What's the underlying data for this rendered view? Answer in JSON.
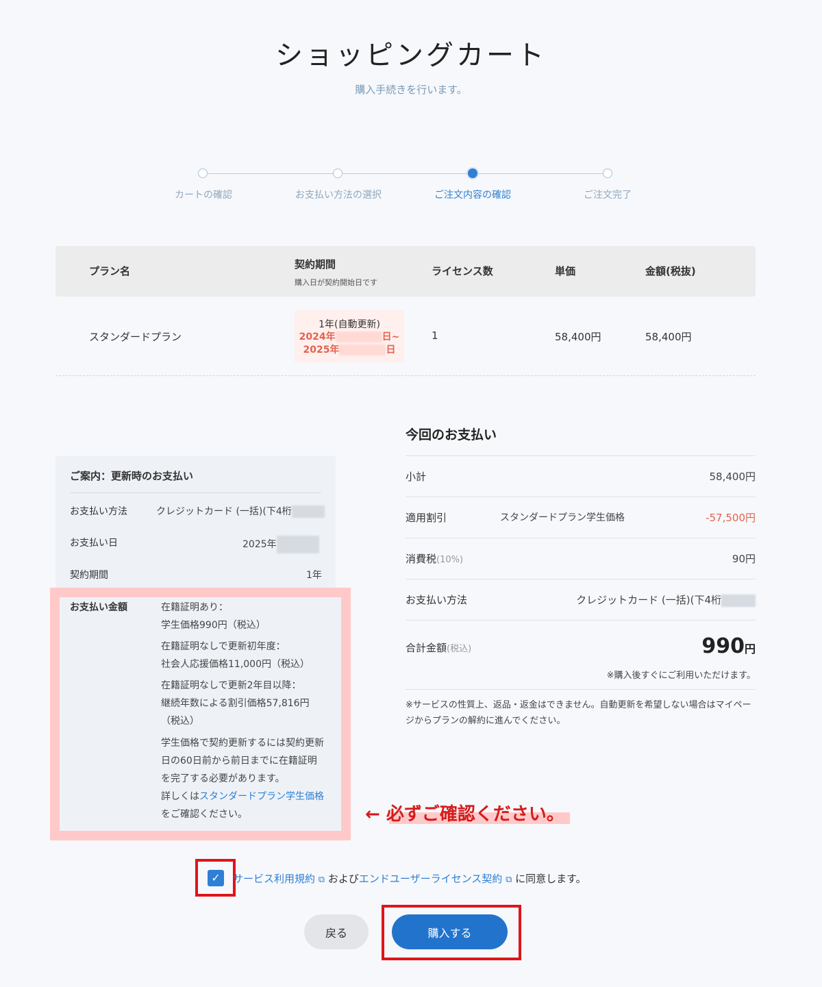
{
  "header": {
    "title": "ショッピングカート",
    "subtitle": "購入手続きを行います。"
  },
  "stepper": {
    "steps": [
      {
        "label": "カートの確認",
        "active": false
      },
      {
        "label": "お支払い方法の選択",
        "active": false
      },
      {
        "label": "ご注文内容の確認",
        "active": true
      },
      {
        "label": "ご注文完了",
        "active": false
      }
    ]
  },
  "table": {
    "headers": {
      "plan": "プラン名",
      "period": "契約期間",
      "period_note": "購入日が契約開始日です",
      "licenses": "ライセンス数",
      "unit_price": "単価",
      "amount": "金額(税抜)"
    },
    "row": {
      "plan": "スタンダードプラン",
      "period_kind": "1年(自動更新)",
      "period_start": "2024年",
      "period_start_suffix": "日~",
      "period_end": "2025年",
      "period_end_suffix": "日",
      "licenses": "1",
      "unit_price": "58,400円",
      "amount": "58,400円"
    }
  },
  "info_card": {
    "title": "ご案内：更新時のお支払い",
    "payment_method_label": "お支払い方法",
    "payment_method_value": "クレジットカード (一括)(下4桁",
    "payment_date_label": "お支払い日",
    "payment_date_value": "2025年",
    "period_label": "契約期間",
    "period_value": "1年",
    "amount_label": "お支払い金額",
    "amount_lines": [
      "在籍証明あり：",
      "学生価格990円（税込）",
      "在籍証明なしで更新初年度：",
      "社会人応援価格11,000円（税込）",
      "在籍証明なしで更新2年目以降：",
      "継続年数による割引価格57,816円",
      "（税込）",
      "学生価格で契約更新するには契約更新",
      "日の60日前から前日までに在籍証明",
      "を完了する必要があります。"
    ],
    "details_prefix": "詳しくは",
    "details_link": "スタンダードプラン学生価格",
    "details_suffix": "をご確認ください。"
  },
  "summary": {
    "title": "今回のお支払い",
    "subtotal_label": "小計",
    "subtotal_value": "58,400円",
    "discount_label": "適用割引",
    "discount_name": "スタンダードプラン学生価格",
    "discount_value": "-57,500円",
    "tax_label": "消費税",
    "tax_rate": "(10%)",
    "tax_value": "90円",
    "method_label": "お支払い方法",
    "method_value": "クレジットカード (一括)(下4桁",
    "total_label": "合計金額",
    "total_tax_note": "(税込)",
    "total_amount": "990",
    "total_unit": "円",
    "immediate_note": "※購入後すぐにご利用いただけます。",
    "refund_note": "※サービスの性質上、返品・返金はできません。自動更新を希望しない場合はマイページからプランの解約に進んでください。"
  },
  "annotation": {
    "text": "← 必ずご確認ください。"
  },
  "agreement": {
    "checked": true,
    "terms_link": "サービス利用規約",
    "and_text": " および",
    "eula_link": "エンドユーザーライセンス契約",
    "agree_text": " に同意します。"
  },
  "buttons": {
    "back": "戻る",
    "buy": "購入する"
  },
  "colors": {
    "accent": "#2273cc",
    "discount": "#e3624f",
    "highlight": "#ffc9c9",
    "frame_red": "#e0141b"
  }
}
